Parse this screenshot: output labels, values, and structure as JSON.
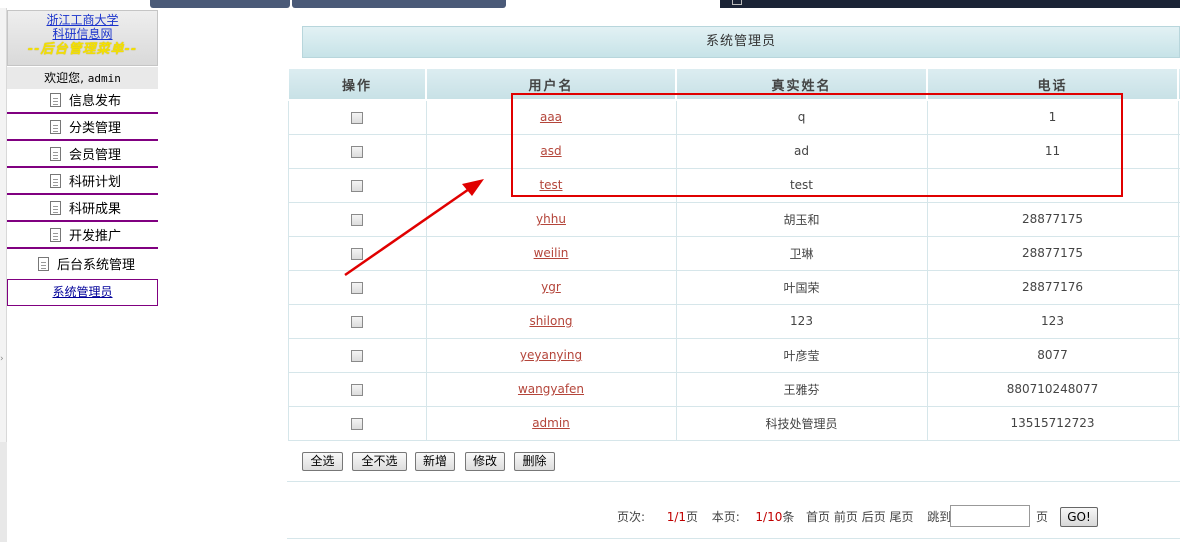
{
  "sidebar": {
    "logo": {
      "line1": "浙江工商大学",
      "line2": "科研信息网",
      "line3": "--后台管理菜单--"
    },
    "welcome": {
      "label": "欢迎您,",
      "user": "admin"
    },
    "items": [
      {
        "label": "信息发布"
      },
      {
        "label": "分类管理"
      },
      {
        "label": "会员管理"
      },
      {
        "label": "科研计划"
      },
      {
        "label": "科研成果"
      },
      {
        "label": "开发推广"
      },
      {
        "label": "后台系统管理"
      }
    ],
    "selected": "系统管理员"
  },
  "main": {
    "title": "系统管理员",
    "columns": [
      "操作",
      "用户名",
      "真实姓名",
      "电话"
    ],
    "rows": [
      {
        "username": "aaa",
        "realname": "q",
        "phone": "1"
      },
      {
        "username": "asd",
        "realname": "ad",
        "phone": "11"
      },
      {
        "username": "test",
        "realname": "test",
        "phone": ""
      },
      {
        "username": "yhhu",
        "realname": "胡玉和",
        "phone": "28877175"
      },
      {
        "username": "weilin",
        "realname": "卫琳",
        "phone": "28877175"
      },
      {
        "username": "ygr",
        "realname": "叶国荣",
        "phone": "28877176"
      },
      {
        "username": "shilong",
        "realname": "123",
        "phone": "123"
      },
      {
        "username": "yeyanying",
        "realname": "叶彦莹",
        "phone": "8077"
      },
      {
        "username": "wangyafen",
        "realname": "王雅芬",
        "phone": "880710248077"
      },
      {
        "username": "admin",
        "realname": "科技处管理员",
        "phone": "13515712723"
      }
    ],
    "buttons": {
      "select_all": "全选",
      "select_none": "全不选",
      "add": "新增",
      "edit": "修改",
      "delete": "删除"
    },
    "pager": {
      "page_label": "页次:",
      "page_value": "1/1",
      "page_unit": "页",
      "per_label": "本页:",
      "per_value": "1/10",
      "per_unit": "条",
      "first": "首页",
      "prev": "前页",
      "next": "后页",
      "last": "尾页",
      "jump_label": "跳到",
      "jump_unit": "页",
      "go": "GO!"
    }
  },
  "annotation": {
    "box_color": "#e00000",
    "arrow_color": "#e00000"
  }
}
